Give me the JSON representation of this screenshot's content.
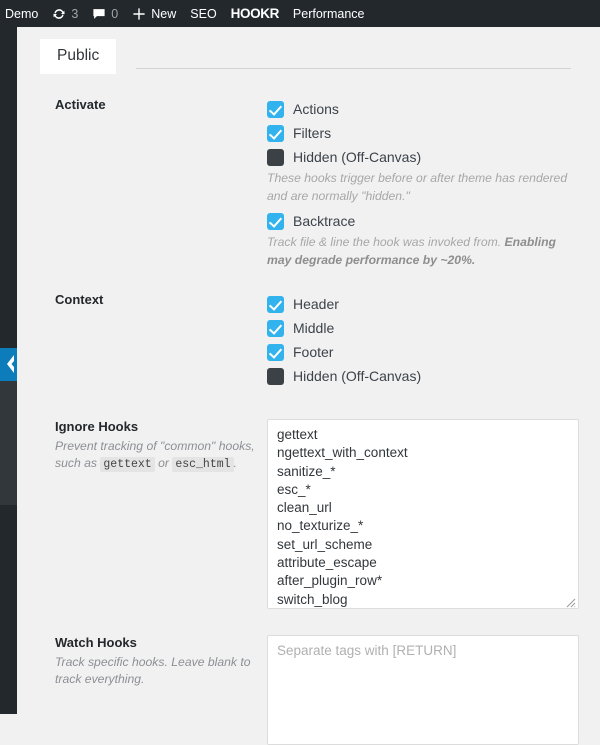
{
  "adminbar": {
    "site_name": "Demo",
    "updates_icon": "refresh-icon",
    "updates_count": "3",
    "comments_icon": "comment-bubble-icon",
    "comments_count": "0",
    "new_icon": "plus-icon",
    "new_label": "New",
    "seo_label": "SEO",
    "logo_label": "HOOKR",
    "performance_label": "Performance"
  },
  "rail": {
    "collapse_icon": "chevron-left-icon",
    "accent_color": "#0c7cba"
  },
  "tabs": [
    {
      "label": "Public",
      "active": true
    }
  ],
  "sections": {
    "activate": {
      "label": "Activate",
      "options": [
        {
          "label": "Actions",
          "checked": true
        },
        {
          "label": "Filters",
          "checked": true
        },
        {
          "label": "Hidden (Off-Canvas)",
          "checked": false
        }
      ],
      "hidden_help": "These hooks trigger before or after theme has rendered and are normally \"hidden.\"",
      "backtrace": {
        "label": "Backtrace",
        "checked": true
      },
      "backtrace_help_plain": "Track file & line the hook was invoked from. ",
      "backtrace_help_bold": "Enabling may degrade performance by ~20%."
    },
    "context": {
      "label": "Context",
      "options": [
        {
          "label": "Header",
          "checked": true
        },
        {
          "label": "Middle",
          "checked": true
        },
        {
          "label": "Footer",
          "checked": true
        },
        {
          "label": "Hidden (Off-Canvas)",
          "checked": false
        }
      ]
    },
    "ignore_hooks": {
      "label": "Ignore Hooks",
      "desc_part1": "Prevent tracking of \"common\" hooks,",
      "desc_part2": "such as ",
      "code1": "gettext",
      "desc_or": " or ",
      "code2": "esc_html",
      "desc_end": ".",
      "value": "gettext\nngettext_with_context\nsanitize_*\nesc_*\nclean_url\nno_texturize_*\nset_url_scheme\nattribute_escape\nafter_plugin_row*\nswitch_blog",
      "resize_icon": "resize-grip-icon"
    },
    "watch_hooks": {
      "label": "Watch Hooks",
      "desc": "Track specific hooks. Leave blank to track everything.",
      "placeholder": "Separate tags with [RETURN]",
      "value": ""
    }
  },
  "colors": {
    "checkbox_on": "#33b3ee",
    "checkbox_off": "#3c4145",
    "adminbar_bg": "#23282d",
    "page_bg": "#f1f1f1"
  }
}
